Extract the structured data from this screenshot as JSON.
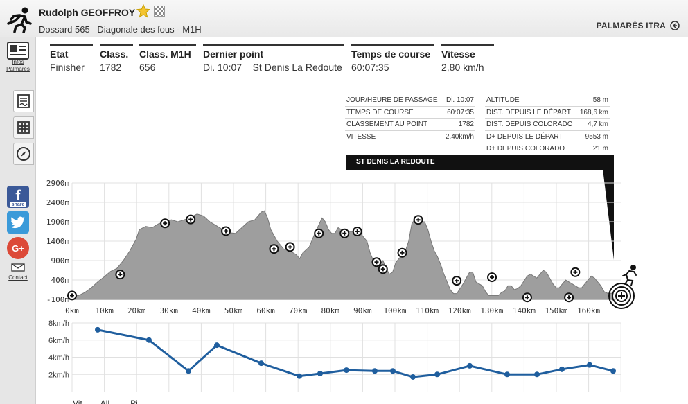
{
  "header": {
    "runner_name": "Rudolph GEOFFROY",
    "bib": "Dossard 565",
    "race": "Diagonale des fous - M1H",
    "palmares_link": "PALMARÈS ITRA"
  },
  "sidebar": {
    "infos_label_line1": "Infos",
    "infos_label_line2": "Palmares",
    "contact_label": "Contact",
    "facebook_share": "share"
  },
  "stats": [
    {
      "header": "Etat",
      "value": "Finisher"
    },
    {
      "header": "Class.",
      "value": "1782"
    },
    {
      "header": "Class. M1H",
      "value": "656"
    },
    {
      "header": "Dernier point",
      "value": "Di. 10:07    St Denis La Redoute"
    },
    {
      "header": "Temps de course",
      "value": "60:07:35"
    },
    {
      "header": "Vitesse",
      "value": "2,80 km/h"
    }
  ],
  "info_left": [
    {
      "label": "JOUR/HEURE DE PASSAGE",
      "value": "Di. 10:07"
    },
    {
      "label": "TEMPS DE COURSE",
      "value": "60:07:35"
    },
    {
      "label": "CLASSEMENT AU POINT",
      "value": "1782"
    },
    {
      "label": "VITESSE",
      "value": "2,40km/h"
    }
  ],
  "info_right": [
    {
      "label": "ALTITUDE",
      "value": "58 m"
    },
    {
      "label": "DIST. DEPUIS LE DÉPART",
      "value": "168,6 km"
    },
    {
      "label": "DIST. DEPUIS COLORADO",
      "value": "4,7 km"
    },
    {
      "label": "D+ DEPUIS LE DÉPART",
      "value": "9553 m"
    },
    {
      "label": "D+ DEPUIS COLORADO",
      "value": "21 m"
    }
  ],
  "info_banner": "ST DENIS LA REDOUTE",
  "chart_data": [
    {
      "type": "area",
      "y_ticks": [
        "2900m",
        "2400m",
        "1900m",
        "1400m",
        "900m",
        "400m",
        "-100m"
      ],
      "x_ticks": [
        "0km",
        "10km",
        "20km",
        "30km",
        "40km",
        "50km",
        "60km",
        "70km",
        "80km",
        "90km",
        "100km",
        "110km",
        "120km",
        "130km",
        "140km",
        "150km",
        "160km"
      ],
      "xlim": [
        0,
        168.6
      ],
      "ylim": [
        -100,
        2900
      ],
      "profile": [
        [
          0,
          0
        ],
        [
          2,
          0
        ],
        [
          4,
          80
        ],
        [
          6,
          200
        ],
        [
          8,
          350
        ],
        [
          10,
          480
        ],
        [
          12,
          620
        ],
        [
          14,
          700
        ],
        [
          16,
          900
        ],
        [
          18,
          1150
        ],
        [
          20,
          1450
        ],
        [
          21,
          1700
        ],
        [
          23,
          1780
        ],
        [
          25,
          1750
        ],
        [
          27,
          1850
        ],
        [
          29,
          1900
        ],
        [
          31,
          1950
        ],
        [
          33,
          1900
        ],
        [
          35,
          1950
        ],
        [
          37,
          2020
        ],
        [
          39,
          2100
        ],
        [
          41,
          2050
        ],
        [
          43,
          1900
        ],
        [
          45,
          1800
        ],
        [
          47,
          1700
        ],
        [
          49,
          1620
        ],
        [
          51,
          1600
        ],
        [
          53,
          1750
        ],
        [
          55,
          1900
        ],
        [
          57,
          1950
        ],
        [
          59,
          2150
        ],
        [
          60,
          2180
        ],
        [
          61,
          2000
        ],
        [
          62,
          1700
        ],
        [
          64,
          1400
        ],
        [
          66,
          1200
        ],
        [
          68,
          1150
        ],
        [
          70,
          1050
        ],
        [
          71,
          950
        ],
        [
          72,
          1100
        ],
        [
          74,
          1250
        ],
        [
          76,
          1650
        ],
        [
          78,
          2000
        ],
        [
          79,
          1900
        ],
        [
          80,
          1700
        ],
        [
          81,
          1600
        ],
        [
          82,
          1600
        ],
        [
          83,
          1750
        ],
        [
          84,
          1700
        ],
        [
          86,
          1650
        ],
        [
          88,
          1650
        ],
        [
          90,
          1600
        ],
        [
          91,
          1500
        ],
        [
          92,
          1400
        ],
        [
          93,
          1100
        ],
        [
          94,
          900
        ],
        [
          96,
          800
        ],
        [
          97,
          900
        ],
        [
          98,
          700
        ],
        [
          99,
          550
        ],
        [
          100,
          600
        ],
        [
          101,
          850
        ],
        [
          103,
          1050
        ],
        [
          104,
          1150
        ],
        [
          105,
          1400
        ],
        [
          106,
          1850
        ],
        [
          107,
          1980
        ],
        [
          108,
          1950
        ],
        [
          109,
          1900
        ],
        [
          110,
          1900
        ],
        [
          111,
          1700
        ],
        [
          112,
          1400
        ],
        [
          113,
          1150
        ],
        [
          114,
          1000
        ],
        [
          115,
          800
        ],
        [
          116,
          550
        ],
        [
          117,
          350
        ],
        [
          118,
          150
        ],
        [
          119,
          50
        ],
        [
          120,
          50
        ],
        [
          122,
          300
        ],
        [
          124,
          600
        ],
        [
          125,
          600
        ],
        [
          126,
          350
        ],
        [
          127,
          300
        ],
        [
          128,
          250
        ],
        [
          129,
          100
        ],
        [
          130,
          0
        ],
        [
          131,
          0
        ],
        [
          132,
          0
        ],
        [
          133,
          0
        ],
        [
          134,
          80
        ],
        [
          135,
          120
        ],
        [
          136,
          250
        ],
        [
          137,
          250
        ],
        [
          138,
          150
        ],
        [
          139,
          180
        ],
        [
          140,
          250
        ],
        [
          142,
          500
        ],
        [
          143,
          550
        ],
        [
          145,
          450
        ],
        [
          146,
          550
        ],
        [
          147,
          650
        ],
        [
          148,
          600
        ],
        [
          149,
          450
        ],
        [
          150,
          300
        ],
        [
          151,
          200
        ],
        [
          152,
          200
        ],
        [
          153,
          300
        ],
        [
          154,
          400
        ],
        [
          155,
          350
        ],
        [
          156,
          300
        ],
        [
          157,
          250
        ],
        [
          158,
          200
        ],
        [
          159,
          200
        ],
        [
          160,
          300
        ],
        [
          161,
          400
        ],
        [
          162,
          500
        ],
        [
          163,
          450
        ],
        [
          164,
          350
        ],
        [
          165,
          250
        ],
        [
          166,
          100
        ],
        [
          167,
          60
        ],
        [
          168.6,
          58
        ]
      ],
      "checkpoints": [
        [
          0,
          0
        ],
        [
          10,
          530
        ],
        [
          20,
          1900
        ],
        [
          26,
          2000
        ],
        [
          33,
          1560
        ],
        [
          43,
          1140
        ],
        [
          47,
          1240
        ],
        [
          53,
          1560
        ],
        [
          60,
          1600
        ],
        [
          64,
          820
        ],
        [
          68,
          600
        ],
        [
          76,
          1010
        ],
        [
          83,
          1950
        ],
        [
          96,
          250
        ],
        [
          106,
          430
        ],
        [
          111,
          0
        ],
        [
          117,
          0
        ],
        [
          124,
          690
        ],
        [
          128,
          -20
        ]
      ],
      "finish": [
        [
          128,
          -20
        ]
      ]
    },
    {
      "type": "line",
      "y_ticks": [
        "8km/h",
        "6km/h",
        "4km/h",
        "2km/h"
      ],
      "ylim": [
        0,
        8
      ],
      "values": [
        7.2,
        6,
        2.4,
        5.4,
        3.3,
        1.8,
        2.1,
        2.5,
        2.4,
        2.4,
        1.7,
        2.0,
        3.0,
        2.0,
        2.0,
        2.6,
        3.1,
        2.4
      ]
    }
  ],
  "legend_cut": "Vit...     All...      Pi..."
}
